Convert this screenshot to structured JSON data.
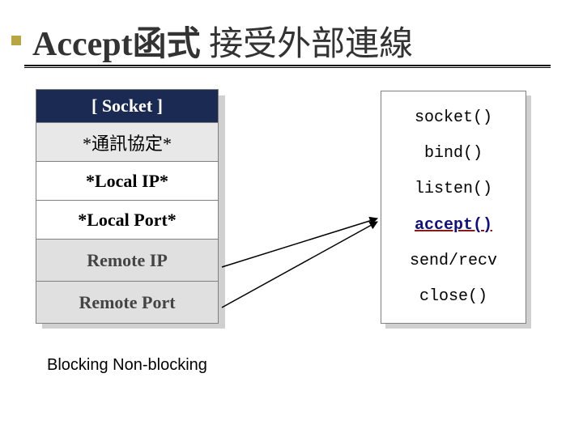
{
  "title": {
    "bold": "Accept函式",
    "thin": " 接受外部連線"
  },
  "socket_table": {
    "header": "[ Socket ]",
    "rows": [
      {
        "key": "proto",
        "label": "*通訊協定*"
      },
      {
        "key": "lip",
        "label": "*Local IP*"
      },
      {
        "key": "lport",
        "label": "*Local Port*"
      },
      {
        "key": "rip",
        "label": "Remote IP"
      },
      {
        "key": "rport",
        "label": "Remote Port"
      }
    ]
  },
  "api_list": [
    {
      "name": "socket()",
      "highlight": false
    },
    {
      "name": "bind()",
      "highlight": false
    },
    {
      "name": "listen()",
      "highlight": false
    },
    {
      "name": "accept()",
      "highlight": true
    },
    {
      "name": "send/recv",
      "highlight": false
    },
    {
      "name": "close()",
      "highlight": false
    }
  ],
  "footer": "Blocking Non-blocking",
  "colors": {
    "header_bg": "#1a2a52",
    "accent_square": "#b8a642",
    "accept_color": "#101080"
  },
  "arrows": {
    "from_rows": [
      "rip",
      "rport"
    ],
    "to_api": "accept()"
  }
}
